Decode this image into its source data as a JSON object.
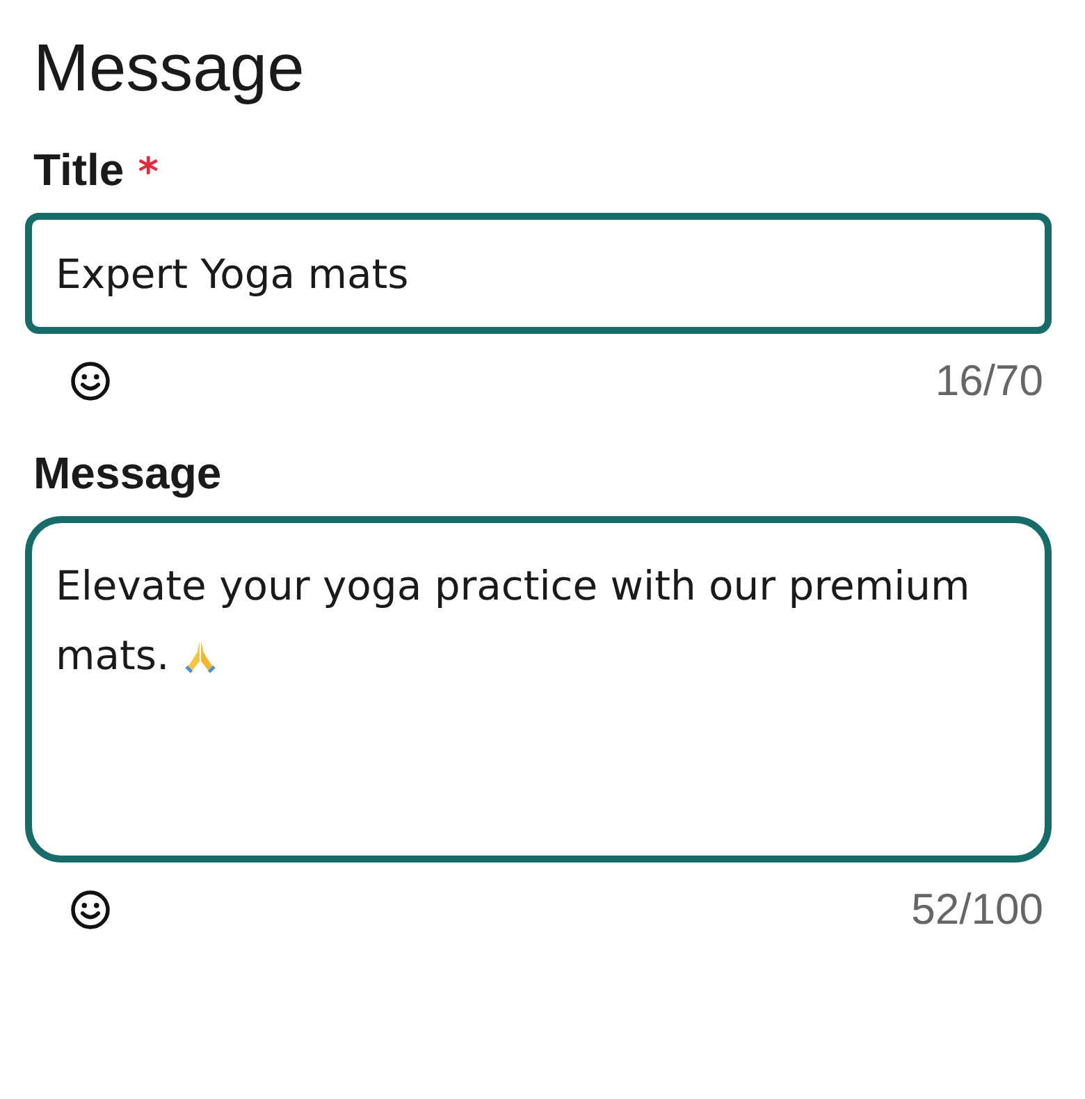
{
  "heading": "Message",
  "fields": [
    {
      "kind": "input",
      "label": "Title",
      "required_mark": "*",
      "value": "Expert Yoga mats",
      "trailing_emoji": false,
      "counter": "16/70"
    },
    {
      "kind": "textarea",
      "label": "Message",
      "value": "Elevate your yoga practice with our premium mats.",
      "trailing_emoji": true,
      "counter": "52/100"
    }
  ]
}
